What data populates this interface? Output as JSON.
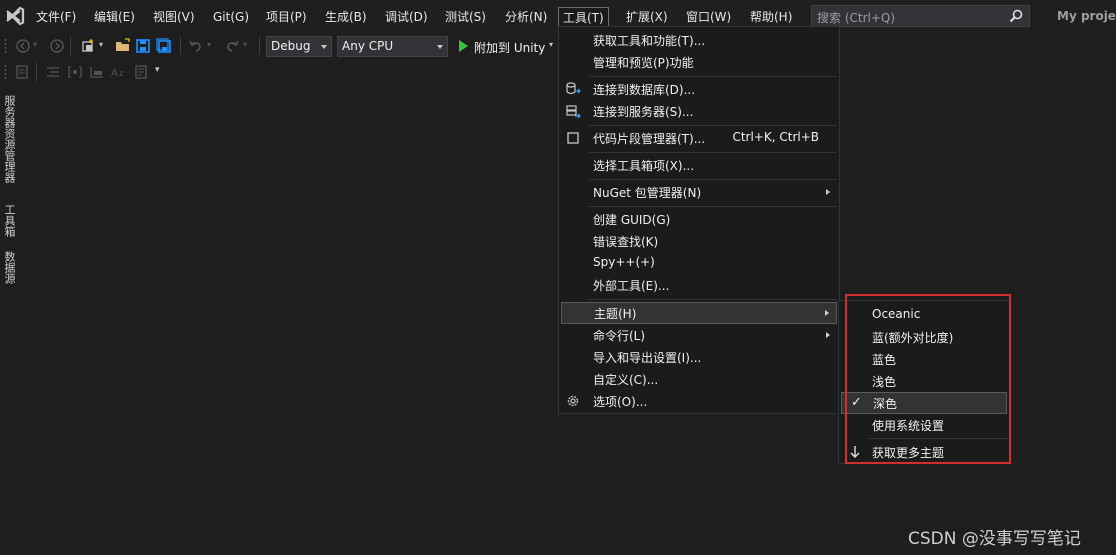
{
  "menubar": {
    "logo_icon": "visual-studio-logo-icon",
    "items": [
      {
        "label": "文件(F)"
      },
      {
        "label": "编辑(E)"
      },
      {
        "label": "视图(V)"
      },
      {
        "label": "Git(G)"
      },
      {
        "label": "项目(P)"
      },
      {
        "label": "生成(B)"
      },
      {
        "label": "调试(D)"
      },
      {
        "label": "测试(S)"
      },
      {
        "label": "分析(N)"
      },
      {
        "label": "工具(T)"
      },
      {
        "label": "扩展(X)"
      },
      {
        "label": "窗口(W)"
      },
      {
        "label": "帮助(H)"
      }
    ],
    "active_item": "工具(T)",
    "search_placeholder": "搜索 (Ctrl+Q)",
    "project_title": "My projec"
  },
  "toolbar": {
    "config": "Debug",
    "platform": "Any CPU",
    "attach_label": "附加到 Unity",
    "icons": [
      "back-icon",
      "forward-icon",
      "new-item-icon",
      "open-folder-icon",
      "save-icon",
      "save-all-icon",
      "undo-icon",
      "redo-icon",
      "play-icon"
    ]
  },
  "side_tabs": [
    "服务器资源管理器",
    "工具箱",
    "数据源"
  ],
  "tools_menu": {
    "groups": [
      [
        {
          "label": "获取工具和功能(T)..."
        },
        {
          "label": "管理和预览(P)功能"
        }
      ],
      [
        {
          "label": "连接到数据库(D)...",
          "icon": "database-icon"
        },
        {
          "label": "连接到服务器(S)...",
          "icon": "server-icon"
        }
      ],
      [
        {
          "label": "代码片段管理器(T)...",
          "shortcut": "Ctrl+K, Ctrl+B",
          "icon": "snippet-icon"
        }
      ],
      [
        {
          "label": "选择工具箱项(X)..."
        }
      ],
      [
        {
          "label": "NuGet 包管理器(N)",
          "submenu": true
        }
      ],
      [
        {
          "label": "创建 GUID(G)"
        },
        {
          "label": "错误查找(K)"
        },
        {
          "label": "Spy++(+)"
        },
        {
          "label": "外部工具(E)..."
        }
      ],
      [
        {
          "label": "主题(H)",
          "submenu": true,
          "highlighted": true
        },
        {
          "label": "命令行(L)",
          "submenu": true
        },
        {
          "label": "导入和导出设置(I)..."
        },
        {
          "label": "自定义(C)..."
        },
        {
          "label": "选项(O)...",
          "icon": "gear-icon"
        }
      ]
    ]
  },
  "theme_submenu": {
    "items": [
      {
        "label": "Oceanic"
      },
      {
        "label": "蓝(额外对比度)"
      },
      {
        "label": "蓝色"
      },
      {
        "label": "浅色"
      },
      {
        "label": "深色",
        "checked": true
      },
      {
        "label": "使用系统设置"
      }
    ],
    "more": {
      "label": "获取更多主题",
      "icon": "download-arrow-icon"
    },
    "check_glyph": "✓",
    "highlight_color": "#d42d2d"
  },
  "watermark": "CSDN @没事写写笔记"
}
